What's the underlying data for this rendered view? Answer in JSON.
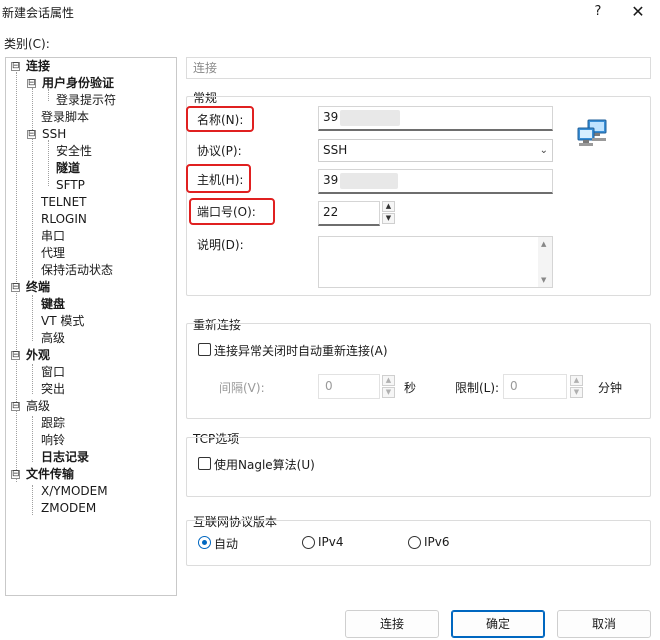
{
  "window": {
    "title": "新建会话属性",
    "help": "?",
    "close": "✕"
  },
  "category_label": "类别(C):",
  "tree": [
    {
      "label": "连接",
      "bold": true
    },
    {
      "label": "用户身份验证",
      "bold": true
    },
    {
      "label": "登录提示符",
      "bold": false
    },
    {
      "label": "登录脚本",
      "bold": false
    },
    {
      "label": "SSH",
      "bold": false
    },
    {
      "label": "安全性",
      "bold": false
    },
    {
      "label": "隧道",
      "bold": true
    },
    {
      "label": "SFTP",
      "bold": false
    },
    {
      "label": "TELNET",
      "bold": false
    },
    {
      "label": "RLOGIN",
      "bold": false
    },
    {
      "label": "串口",
      "bold": false
    },
    {
      "label": "代理",
      "bold": false
    },
    {
      "label": "保持活动状态",
      "bold": false
    },
    {
      "label": "终端",
      "bold": true
    },
    {
      "label": "键盘",
      "bold": true
    },
    {
      "label": "VT 模式",
      "bold": false
    },
    {
      "label": "高级",
      "bold": false
    },
    {
      "label": "外观",
      "bold": true
    },
    {
      "label": "窗口",
      "bold": false
    },
    {
      "label": "突出",
      "bold": false
    },
    {
      "label": "高级",
      "bold": false
    },
    {
      "label": "跟踪",
      "bold": false
    },
    {
      "label": "响铃",
      "bold": false
    },
    {
      "label": "日志记录",
      "bold": true
    },
    {
      "label": "文件传输",
      "bold": true
    },
    {
      "label": "X/YMODEM",
      "bold": false
    },
    {
      "label": "ZMODEM",
      "bold": false
    }
  ],
  "breadcrumb": "连接",
  "general": {
    "title": "常规",
    "name_label": "名称(N):",
    "name_value": "39",
    "protocol_label": "协议(P):",
    "protocol_value": "SSH",
    "host_label": "主机(H):",
    "host_value": "39",
    "port_label": "端口号(O):",
    "port_value": "22",
    "desc_label": "说明(D):"
  },
  "reconnect": {
    "title": "重新连接",
    "checkbox_label": "连接异常关闭时自动重新连接(A)",
    "interval_label": "间隔(V):",
    "interval_value": "0",
    "interval_unit": "秒",
    "limit_label": "限制(L):",
    "limit_value": "0",
    "limit_unit": "分钟"
  },
  "tcp": {
    "title": "TCP选项",
    "nagle_label": "使用Nagle算法(U)"
  },
  "ipver": {
    "title": "互联网协议版本",
    "auto": "自动",
    "ipv4": "IPv4",
    "ipv6": "IPv6"
  },
  "buttons": {
    "connect": "连接",
    "ok": "确定",
    "cancel": "取消"
  },
  "icons": {
    "expanded": "⊟",
    "network": "network-computers-icon"
  },
  "colors": {
    "highlight": "#e02020",
    "accent": "#0067c0"
  }
}
